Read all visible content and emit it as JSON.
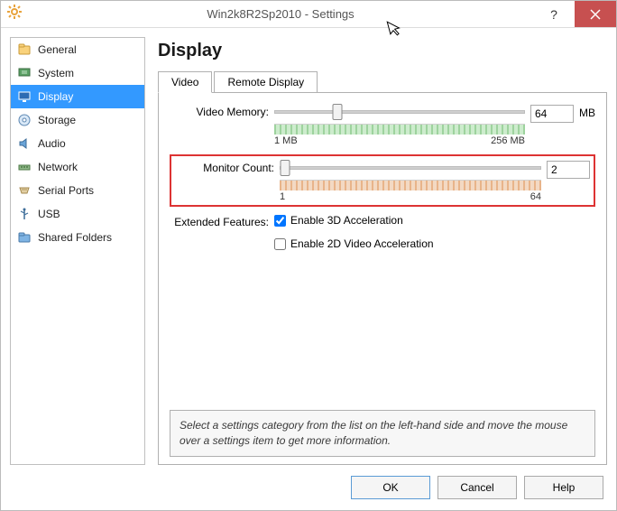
{
  "window": {
    "title": "Win2k8R2Sp2010 - Settings"
  },
  "sidebar": {
    "items": [
      {
        "label": "General"
      },
      {
        "label": "System"
      },
      {
        "label": "Display"
      },
      {
        "label": "Storage"
      },
      {
        "label": "Audio"
      },
      {
        "label": "Network"
      },
      {
        "label": "Serial Ports"
      },
      {
        "label": "USB"
      },
      {
        "label": "Shared Folders"
      }
    ]
  },
  "page": {
    "title": "Display",
    "tabs": {
      "video": "Video",
      "remote": "Remote Display"
    }
  },
  "video": {
    "memory_label": "Video Memory:",
    "memory_value": "64",
    "memory_unit": "MB",
    "memory_min": "1 MB",
    "memory_max": "256 MB",
    "monitor_label": "Monitor Count:",
    "monitor_value": "2",
    "monitor_min": "1",
    "monitor_max": "64",
    "features_label": "Extended Features:",
    "enable3d_label": "Enable 3D Acceleration",
    "enable3d_checked": true,
    "enable2d_label": "Enable 2D Video Acceleration",
    "enable2d_checked": false
  },
  "hint": "Select a settings category from the list on the left-hand side and move the mouse over a settings item to get more information.",
  "buttons": {
    "ok": "OK",
    "cancel": "Cancel",
    "help": "Help"
  }
}
